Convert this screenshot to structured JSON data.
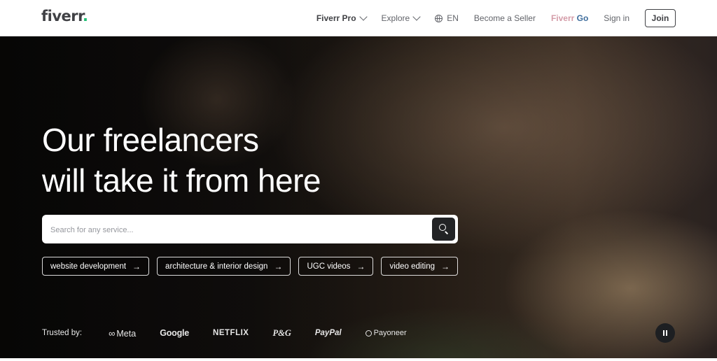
{
  "header": {
    "logo_text": "fiverr",
    "logo_dot": ".",
    "nav": {
      "fiverr_pro": "Fiverr Pro",
      "explore": "Explore",
      "language": "EN",
      "become_seller": "Become a Seller",
      "fiverr_go_part1": "Fiverr",
      "fiverr_go_part2": " Go",
      "sign_in": "Sign in",
      "join": "Join"
    },
    "accent_color": "#1dbf73"
  },
  "hero": {
    "headline_line1": "Our freelancers",
    "headline_line2": "will take it from here",
    "search": {
      "placeholder": "Search for any service...",
      "value": ""
    },
    "chips": [
      {
        "label": "website development",
        "arrow": "→"
      },
      {
        "label": "architecture & interior design",
        "arrow": "→"
      },
      {
        "label": "UGC videos",
        "arrow": "→"
      },
      {
        "label": "video editing",
        "arrow": "→"
      }
    ],
    "trusted_label": "Trusted by:",
    "brands": {
      "meta": "Meta",
      "meta_symbol": "∞",
      "google": "Google",
      "netflix": "NETFLIX",
      "pg": "P&G",
      "paypal": "PayPal",
      "payoneer": "Payoneer"
    }
  }
}
